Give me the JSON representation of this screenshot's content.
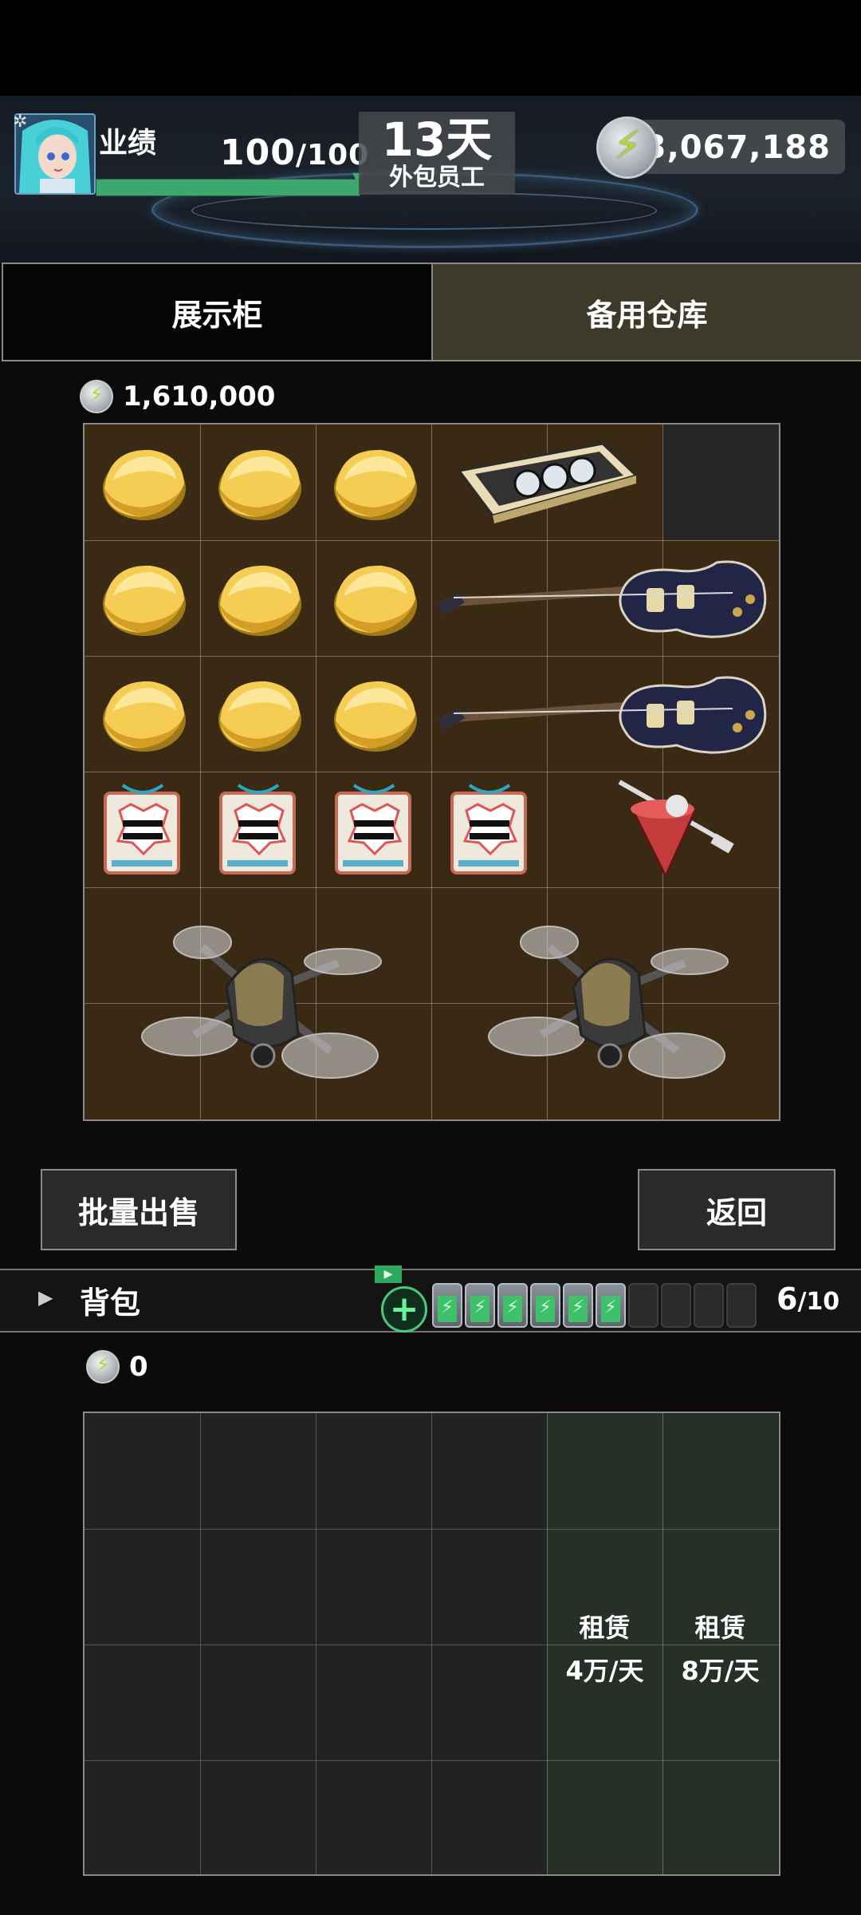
{
  "hud": {
    "kpi_label": "业绩",
    "kpi_current": "100",
    "kpi_max": "100",
    "kpi_progress": 1.0,
    "days": "13天",
    "employee_type": "外包员工",
    "currency": "3,067,188"
  },
  "tabs": [
    {
      "label": "展示柜",
      "active": false
    },
    {
      "label": "备用仓库",
      "active": true
    }
  ],
  "storage": {
    "value": "1,610,000",
    "items": [
      {
        "name": "gold-ingot"
      },
      {
        "name": "gold-ingot"
      },
      {
        "name": "gold-ingot"
      },
      {
        "name": "gold-ingot"
      },
      {
        "name": "gold-ingot"
      },
      {
        "name": "gold-ingot"
      },
      {
        "name": "gold-ingot"
      },
      {
        "name": "gold-ingot"
      },
      {
        "name": "gold-ingot"
      },
      {
        "name": "cassette-tape"
      },
      {
        "name": "electric-guitar"
      },
      {
        "name": "electric-guitar"
      },
      {
        "name": "congratulations-card"
      },
      {
        "name": "congratulations-card"
      },
      {
        "name": "congratulations-card"
      },
      {
        "name": "congratulations-card"
      },
      {
        "name": "spinning-top"
      },
      {
        "name": "drone"
      },
      {
        "name": "drone"
      }
    ]
  },
  "buttons": {
    "bulk_sell": "批量出售",
    "back": "返回"
  },
  "bag": {
    "label": "背包",
    "count": "6",
    "max": "/10",
    "batteries_full": 6,
    "batteries_total": 10,
    "value": "0",
    "rent_label": "租赁",
    "rent_price_1": "4万/天",
    "rent_price_2": "8万/天"
  }
}
